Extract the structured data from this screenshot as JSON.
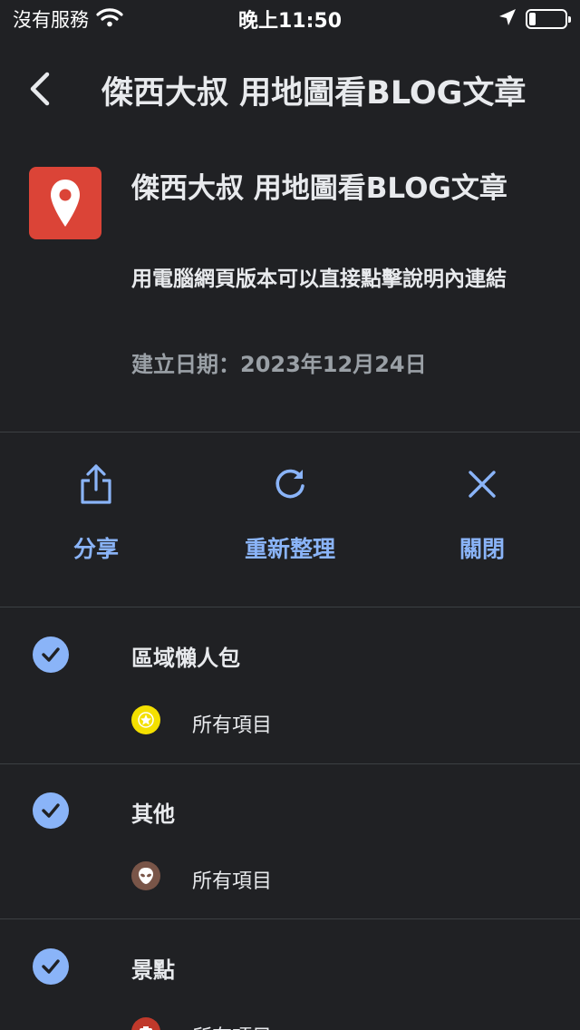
{
  "status_bar": {
    "carrier": "沒有服務",
    "time": "晚上11:50"
  },
  "app_bar": {
    "title": "傑西大叔 用地圖看BLOG文章"
  },
  "map": {
    "title": "傑西大叔 用地圖看BLOG文章",
    "description": "用電腦網頁版本可以直接點擊說明內連結",
    "created": "建立日期：2023年12月24日",
    "logo_color": "#db4437"
  },
  "actions": [
    {
      "label": "分享",
      "icon": "share-icon"
    },
    {
      "label": "重新整理",
      "icon": "refresh-icon"
    },
    {
      "label": "關閉",
      "icon": "close-icon"
    }
  ],
  "layers": [
    {
      "name": "區域懶人包",
      "item_label": "所有項目",
      "icon": "star-marker-icon",
      "icon_color": "#f4e000",
      "checked": true
    },
    {
      "name": "其他",
      "item_label": "所有項目",
      "icon": "alien-marker-icon",
      "icon_color": "#795548",
      "checked": true
    },
    {
      "name": "景點",
      "item_label": "所有項目",
      "icon": "camera-marker-icon",
      "icon_color": "#c0392b",
      "checked": true
    }
  ],
  "colors": {
    "background": "#202124",
    "accent": "#8ab4f8",
    "secondary_text": "#9aa0a6"
  }
}
